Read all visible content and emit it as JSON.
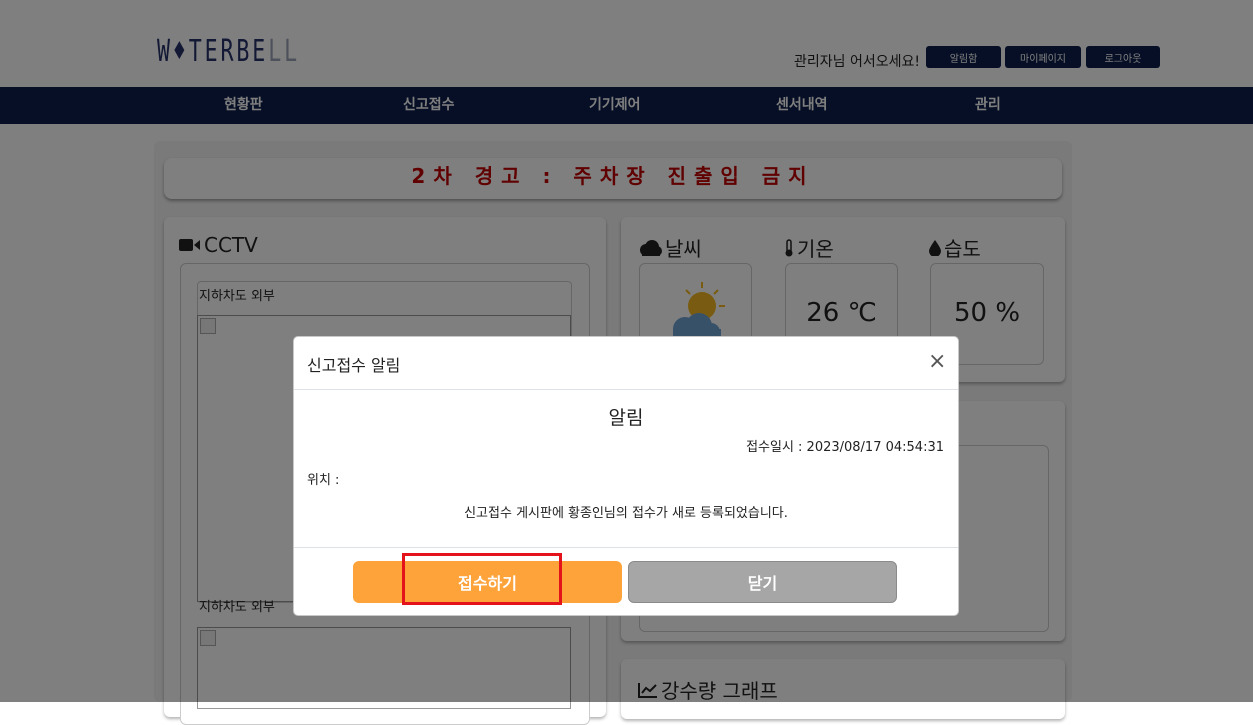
{
  "header": {
    "logo": {
      "w": "W",
      "drop": "♦",
      "rest": "TERBE",
      "fade": "LL"
    },
    "welcome": "관리자님 어서오세요!",
    "buttons": [
      "알림함",
      "마이페이지",
      "로그아웃"
    ]
  },
  "nav": [
    "현황판",
    "신고접수",
    "기기제어",
    "센서내역",
    "관리"
  ],
  "alert_banner": "2차 경고 : 주차장 진출입 금지",
  "cctv": {
    "title": "CCTV",
    "cameras": [
      "지하차도 외부",
      "지하차도 외부"
    ]
  },
  "weather": {
    "title": "날씨",
    "temp_title": "기온",
    "temp_value": "26 ℃",
    "humidity_title": "습도",
    "humidity_value": "50 %"
  },
  "rain_graph": {
    "title": "강수량 그래프"
  },
  "modal": {
    "title": "신고접수 알림",
    "close_icon": "×",
    "heading": "알림",
    "date": "접수일시 : 2023/08/17 04:54:31",
    "location": "위치 :",
    "message": "신고접수 게시판에 황종인님의 접수가 새로 등록되었습니다.",
    "accept_label": "접수하기",
    "close_label": "닫기"
  },
  "colors": {
    "navy": "#0d1f4a",
    "alert_red": "#c00000",
    "accept_orange": "#fda33a",
    "close_gray": "#a6a6a6",
    "highlight_red": "#e3121b"
  }
}
